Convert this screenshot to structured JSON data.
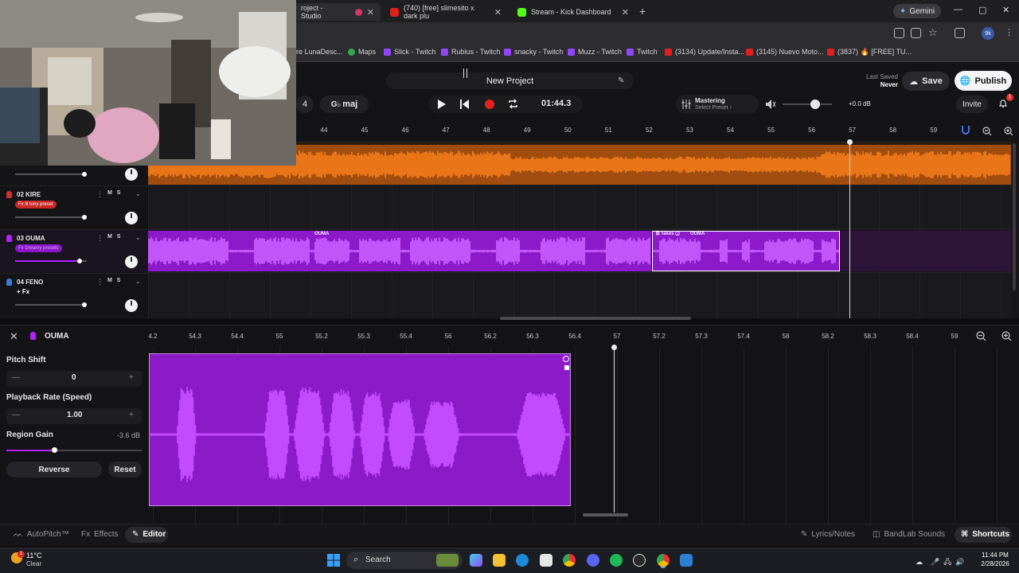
{
  "browser": {
    "tabs": [
      {
        "label": "roject - Studio",
        "active": true,
        "favicon": "bandlab-icon"
      },
      {
        "label": "(740) [free] slimesito x dark plu",
        "active": false,
        "favicon": "youtube-icon"
      },
      {
        "label": "Stream - Kick Dashboard",
        "active": false,
        "favicon": "kick-icon"
      }
    ],
    "gemini_label": "Gemini",
    "profile_badge": "9k",
    "bookmarks": [
      {
        "label": "re LunaDesc...",
        "icon": "bookmark-icon"
      },
      {
        "label": "Maps",
        "icon": "maps-icon"
      },
      {
        "label": "Slick - Twitch",
        "icon": "twitch-icon"
      },
      {
        "label": "Rubius - Twitch",
        "icon": "twitch-icon"
      },
      {
        "label": "snacky - Twitch",
        "icon": "twitch-icon"
      },
      {
        "label": "Muzz - Twitch",
        "icon": "twitch-icon"
      },
      {
        "label": "Twitch",
        "icon": "twitch-icon"
      },
      {
        "label": "(3134) Update/Insta...",
        "icon": "youtube-icon"
      },
      {
        "label": "(3145) Nuevo Moto...",
        "icon": "youtube-icon"
      },
      {
        "label": "(3837) 🔥 [FREE] TU...",
        "icon": "youtube-icon"
      }
    ]
  },
  "header": {
    "project_name": "New Project",
    "last_saved_label": "Last Saved",
    "last_saved_value": "Never",
    "save_label": "Save",
    "publish_label": "Publish",
    "key_number": "4",
    "key_label": "maj",
    "time": "01:44.3",
    "mastering_label": "Mastering",
    "mastering_preset": "Select Preset",
    "volume_db": "+0.0 dB",
    "volume_level": 0.6,
    "invite_label": "Invite",
    "notifications_count": "1"
  },
  "ruler": {
    "ticks": [
      "44",
      "45",
      "46",
      "47",
      "48",
      "49",
      "50",
      "51",
      "52",
      "53",
      "54",
      "55",
      "56",
      "57",
      "58",
      "59"
    ]
  },
  "tracks": [
    {
      "number": "02",
      "name": "KIRE",
      "fx": "Fx lil tony preset",
      "color": "#d03030",
      "volume_level": 0.95
    },
    {
      "number": "03",
      "name": "OUMA",
      "fx": "Fx Dreamy presets",
      "color": "#b321ff",
      "volume_level": 0.9
    },
    {
      "number": "04",
      "name": "FENO",
      "fx": "+ Fx",
      "color": "#3a7bd5",
      "volume_level": 0.95
    }
  ],
  "track_controls": {
    "mute": "M",
    "solo": "S"
  },
  "clips": {
    "ouma_main_label": "OUMA",
    "takes_label": "Takes",
    "takes_clip_label": "OUMA"
  },
  "editor": {
    "region_name": "OUMA",
    "ruler_ticks": [
      "4.2",
      "54.3",
      "54.4",
      "55",
      "55.2",
      "55.3",
      "55.4",
      "56",
      "56.2",
      "56.3",
      "56.4",
      "57",
      "57.2",
      "57.3",
      "57.4",
      "58",
      "58.2",
      "58.3",
      "58.4",
      "59"
    ],
    "pitch_shift_label": "Pitch Shift",
    "pitch_shift_value": "0",
    "playback_rate_label": "Playback Rate (Speed)",
    "playback_rate_value": "1.00",
    "region_gain_label": "Region Gain",
    "region_gain_value": "-3.6 dB",
    "region_gain_level": 0.35,
    "reverse_label": "Reverse",
    "reset_label": "Reset"
  },
  "bottom_bar": {
    "autopitch": "AutoPitch™",
    "effects": "Effects",
    "editor": "Editor",
    "lyrics": "Lyrics/Notes",
    "sounds": "BandLab Sounds",
    "shortcuts": "Shortcuts"
  },
  "taskbar": {
    "temperature": "11°C",
    "weather": "Clear",
    "weather_badge": "1",
    "search_label": "Search",
    "time": "11:44 PM",
    "date": "2/28/2026"
  },
  "colors": {
    "orange_track": "#f07a1a",
    "purple_track": "#b321ff",
    "record_red": "#e52020",
    "accent_blue": "#4a6cf7"
  }
}
